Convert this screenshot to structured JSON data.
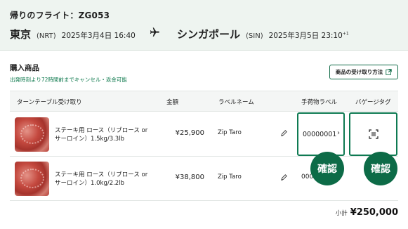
{
  "flight": {
    "title": "帰りのフライト：ZG053",
    "departure": {
      "city": "東京",
      "code": "(NRT)",
      "datetime": "2025年3月4日 16:40"
    },
    "arrival": {
      "city": "シンガポール",
      "code": "(SIN)",
      "datetime": "2025年3月5日 23:10",
      "day_offset": "+1"
    }
  },
  "purchase": {
    "title": "購入商品",
    "cancel_note": "出発時刻より72時間前までキャンセル・返金可能",
    "receive_button": "商品の受け取り方法"
  },
  "table": {
    "headers": {
      "product": "ターンテーブル受け取り",
      "amount": "金額",
      "label_name": "ラベルネーム",
      "hand_label": "手荷物ラベル",
      "baggage_tag": "バゲージタグ"
    },
    "rows": [
      {
        "name": "ステーキ用 ロース（リブロース or サーロイン）1.5kg/3.3lb",
        "price": "¥25,900",
        "label_name": "Zip Taro",
        "hand_label": "00000001",
        "chevron": "›"
      },
      {
        "name": "ステーキ用 ロース（リブロース or サーロイン）1.0kg/2.2lb",
        "price": "¥38,800",
        "label_name": "Zip Taro",
        "hand_label": "000"
      }
    ]
  },
  "confirm_label": "確認",
  "subtotal": {
    "label": "小計",
    "value": "¥250,000"
  },
  "colors": {
    "accent": "#0d6b47",
    "header_bg": "#eef4f0",
    "note_green": "#0f7a4e"
  },
  "icons": {
    "plane": "airplane-icon",
    "external": "external-link-icon",
    "edit": "pencil-icon",
    "scan": "scan-icon"
  }
}
